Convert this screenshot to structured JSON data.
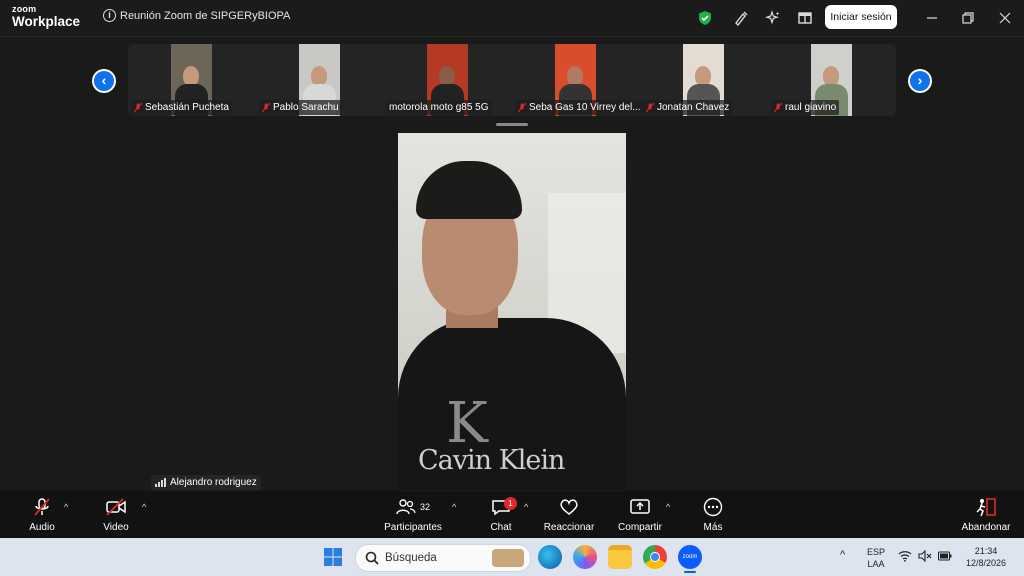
{
  "app": {
    "logo_small": "zoom",
    "logo_big": "Workplace",
    "meeting_title": "Reunión Zoom de SIPGERyBIOPA",
    "signin_label": "Iniciar sesión"
  },
  "participants_strip": [
    {
      "name": "Sebastián Pucheta",
      "muted": true
    },
    {
      "name": "Pablo Sarachu",
      "muted": true
    },
    {
      "name": "motorola moto g85 5G",
      "muted": false
    },
    {
      "name": "Seba Gas 10 Virrey del...",
      "muted": true
    },
    {
      "name": "Jonatan Chavez",
      "muted": true
    },
    {
      "name": "raul giavino",
      "muted": true
    }
  ],
  "active_speaker": {
    "name": "Alejandro rodriguez",
    "shirt_text": "Cavin Klein",
    "shirt_logo": "K"
  },
  "toolbar": {
    "audio": "Audio",
    "video": "Video",
    "participants": "Participantes",
    "participants_count": "32",
    "chat": "Chat",
    "chat_badge": "1",
    "react": "Reaccionar",
    "share": "Compartir",
    "more": "Más",
    "leave": "Abandonar"
  },
  "taskbar": {
    "search_placeholder": "Búsqueda",
    "lang_top": "ESP",
    "lang_bottom": "LAA",
    "time": "21:34",
    "date": "12/8/2026",
    "zoom_app_label": "zoom"
  },
  "colors": {
    "accent": "#0e72ed",
    "leave_red": "#e02828",
    "shield_green": "#1fb345"
  }
}
